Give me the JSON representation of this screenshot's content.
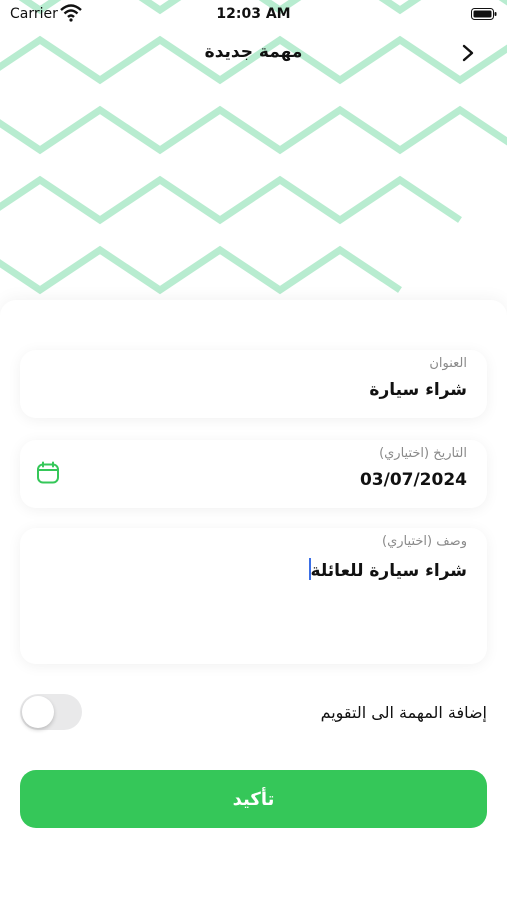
{
  "status_bar": {
    "carrier": "Carrier",
    "time": "12:03 AM"
  },
  "nav": {
    "title": "مهمة جديدة",
    "back_icon": "chevron-right-icon"
  },
  "theme": {
    "accent": "#35c759",
    "pattern": "#b8ecd0"
  },
  "form": {
    "title": {
      "label": "العنوان",
      "value": "شراء سيارة"
    },
    "date": {
      "label": "التاريخ (اختياري)",
      "value": "03/07/2024",
      "icon": "calendar-icon"
    },
    "description": {
      "label": "وصف (اختياري)",
      "value": "شراء سيارة للعائلة"
    },
    "calendar_toggle": {
      "label": "إضافة المهمة الى التقويم",
      "on": false
    },
    "confirm_label": "تأكيد"
  }
}
